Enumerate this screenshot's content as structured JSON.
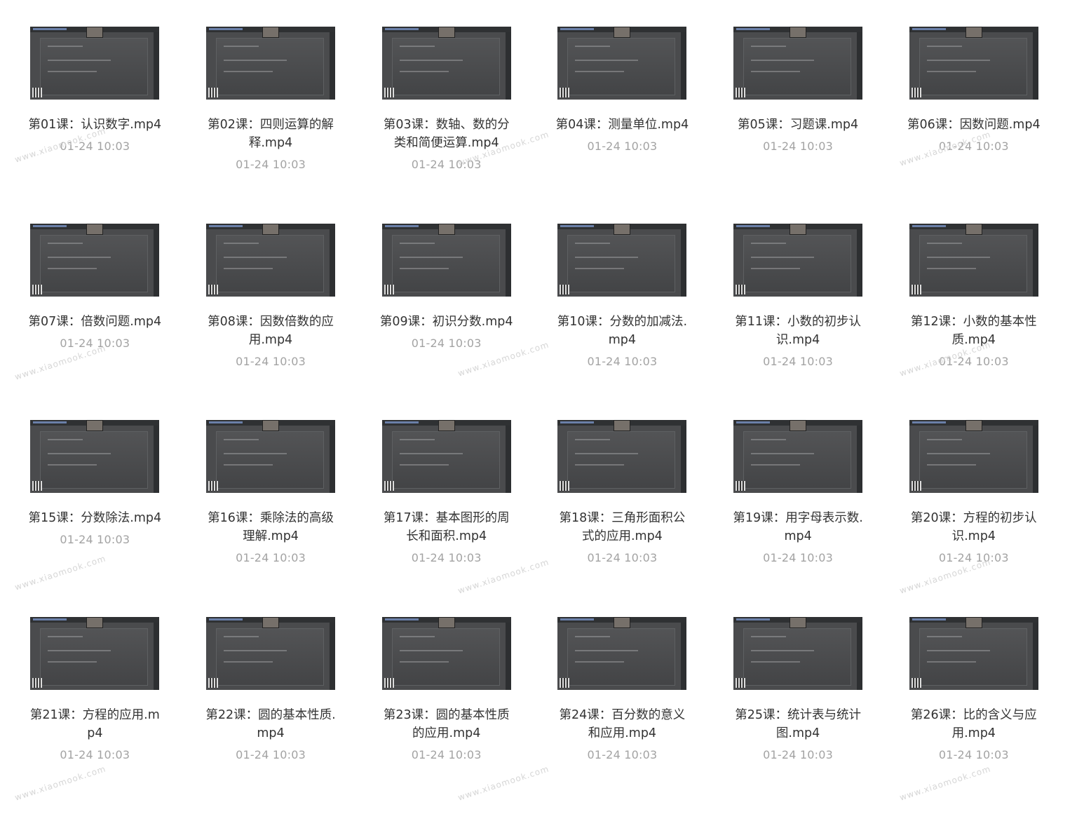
{
  "lessons": [
    {
      "title": "第01课：认识数字.mp4",
      "time": "01-24 10:03"
    },
    {
      "title": "第02课：四则运算的解释.mp4",
      "time": "01-24 10:03"
    },
    {
      "title": "第03课：数轴、数的分类和简便运算.mp4",
      "time": "01-24 10:03"
    },
    {
      "title": "第04课：测量单位.mp4",
      "time": "01-24 10:03"
    },
    {
      "title": "第05课：习题课.mp4",
      "time": "01-24 10:03"
    },
    {
      "title": "第06课：因数问题.mp4",
      "time": "01-24 10:03"
    },
    {
      "title": "第07课：倍数问题.mp4",
      "time": "01-24 10:03"
    },
    {
      "title": "第08课：因数倍数的应用.mp4",
      "time": "01-24 10:03"
    },
    {
      "title": "第09课：初识分数.mp4",
      "time": "01-24 10:03"
    },
    {
      "title": "第10课：分数的加减法.mp4",
      "time": "01-24 10:03"
    },
    {
      "title": "第11课：小数的初步认识.mp4",
      "time": "01-24 10:03"
    },
    {
      "title": "第12课：小数的基本性质.mp4",
      "time": "01-24 10:03"
    },
    {
      "title": "第15课：分数除法.mp4",
      "time": "01-24 10:03"
    },
    {
      "title": "第16课：乘除法的高级理解.mp4",
      "time": "01-24 10:03"
    },
    {
      "title": "第17课：基本图形的周长和面积.mp4",
      "time": "01-24 10:03"
    },
    {
      "title": "第18课：三角形面积公式的应用.mp4",
      "time": "01-24 10:03"
    },
    {
      "title": "第19课：用字母表示数.mp4",
      "time": "01-24 10:03"
    },
    {
      "title": "第20课：方程的初步认识.mp4",
      "time": "01-24 10:03"
    },
    {
      "title": "第21课：方程的应用.mp4",
      "time": "01-24 10:03"
    },
    {
      "title": "第22课：圆的基本性质.mp4",
      "time": "01-24 10:03"
    },
    {
      "title": "第23课：圆的基本性质的应用.mp4",
      "time": "01-24 10:03"
    },
    {
      "title": "第24课：百分数的意义和应用.mp4",
      "time": "01-24 10:03"
    },
    {
      "title": "第25课：统计表与统计图.mp4",
      "time": "01-24 10:03"
    },
    {
      "title": "第26课：比的含义与应用.mp4",
      "time": "01-24 10:03"
    }
  ],
  "watermark": "www.xiaomook.com"
}
